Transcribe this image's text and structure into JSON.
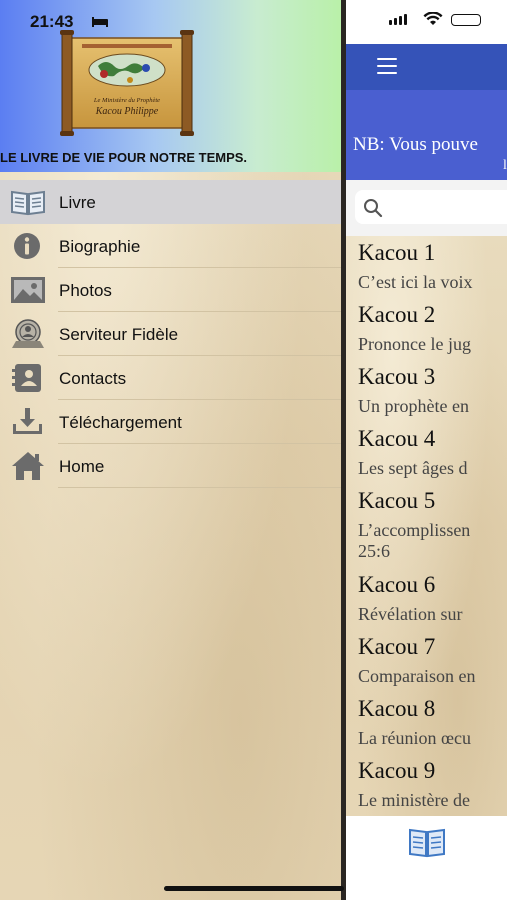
{
  "status": {
    "time": "21:43"
  },
  "drawer": {
    "tagline": "LE LIVRE DE VIE POUR NOTRE TEMPS.",
    "logo": {
      "line1": "Le Ministère du Prophète",
      "line2": "Kacou Philippe"
    },
    "items": [
      {
        "label": "Livre",
        "icon": "book-icon",
        "active": true
      },
      {
        "label": "Biographie",
        "icon": "info-icon"
      },
      {
        "label": "Photos",
        "icon": "photo-icon"
      },
      {
        "label": "Serviteur Fidèle",
        "icon": "seal-icon"
      },
      {
        "label": "Contacts",
        "icon": "contacts-icon"
      },
      {
        "label": "Téléchargement",
        "icon": "download-icon"
      },
      {
        "label": "Home",
        "icon": "home-icon"
      }
    ]
  },
  "main": {
    "banner": {
      "text": "NB: Vous pouve",
      "line2": "l"
    },
    "sermons": [
      {
        "title": "Kacou 1",
        "subtitle": "C’est ici la voix"
      },
      {
        "title": "Kacou 2",
        "subtitle": "Prononce le jug"
      },
      {
        "title": "Kacou 3",
        "subtitle": "Un prophète en"
      },
      {
        "title": "Kacou 4",
        "subtitle": "Les sept âges d"
      },
      {
        "title": "Kacou 5",
        "subtitle": "L’accomplissen",
        "subtitle2": "25:6"
      },
      {
        "title": "Kacou 6",
        "subtitle": "Révélation sur"
      },
      {
        "title": "Kacou 7",
        "subtitle": "Comparaison en"
      },
      {
        "title": "Kacou 8",
        "subtitle": "La réunion œcu"
      },
      {
        "title": "Kacou 9",
        "subtitle": "Le ministère de"
      }
    ]
  },
  "colors": {
    "navbar": "#3553b8",
    "banner": "#4a5fd0",
    "parchment": "#e9dcc0",
    "active_item": "#d4d3d6"
  }
}
